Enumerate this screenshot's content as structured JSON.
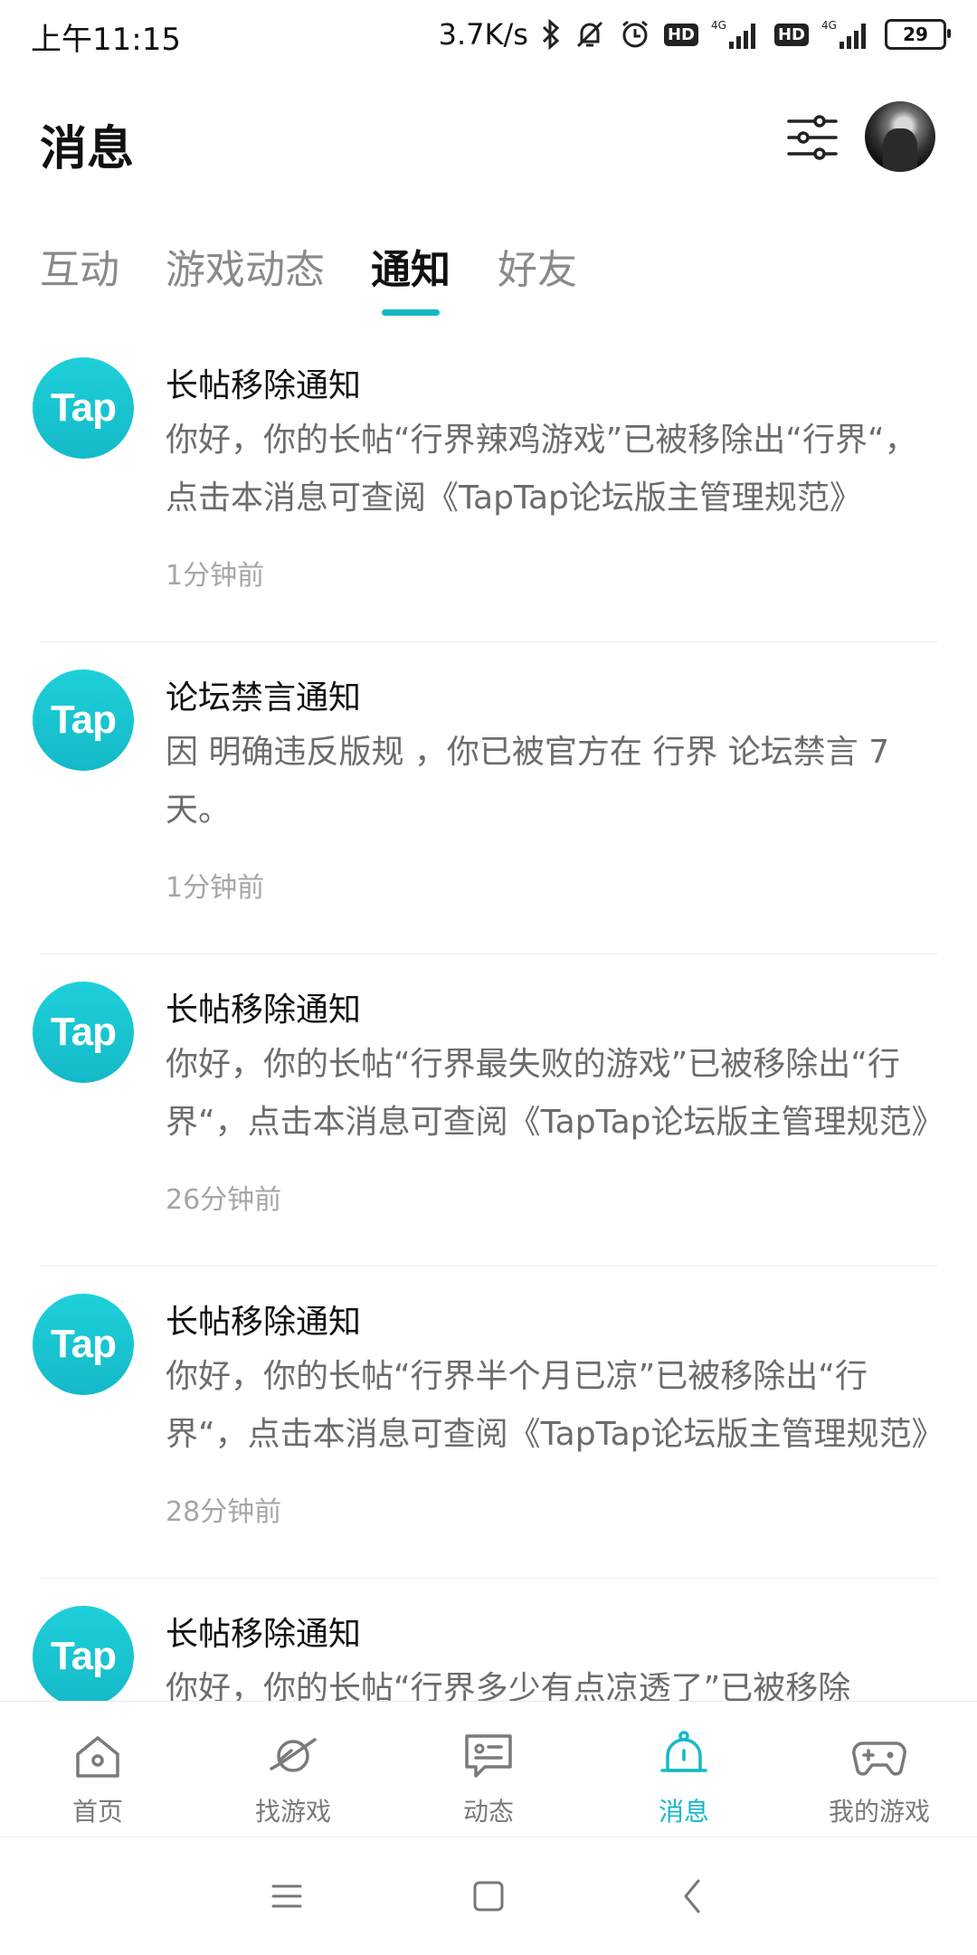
{
  "status_bar": {
    "time": "上午11:15",
    "net_speed": "3.7K/s",
    "battery": "29",
    "hd1": "HD",
    "hd2": "HD",
    "sig1": "4G",
    "sig2": "4G"
  },
  "header": {
    "title": "消息"
  },
  "tabs": [
    {
      "label": "互动"
    },
    {
      "label": "游戏动态"
    },
    {
      "label": "通知",
      "active": true
    },
    {
      "label": "好友"
    }
  ],
  "notifications": [
    {
      "logo": "Tap",
      "title": "长帖移除通知",
      "body": "你好，你的长帖“行界辣鸡游戏”已被移除出“行界“，点击本消息可查阅《TapTap论坛版主管理规范》",
      "time": "1分钟前"
    },
    {
      "logo": "Tap",
      "title": "论坛禁言通知",
      "body": "因 明确违反版规 ，你已被官方在 行界 论坛禁言 7 天。",
      "time": "1分钟前"
    },
    {
      "logo": "Tap",
      "title": "长帖移除通知",
      "body": "你好，你的长帖“行界最失败的游戏”已被移除出“行界“，点击本消息可查阅《TapTap论坛版主管理规范》",
      "time": "26分钟前"
    },
    {
      "logo": "Tap",
      "title": "长帖移除通知",
      "body": "你好，你的长帖“行界半个月已凉”已被移除出“行界“，点击本消息可查阅《TapTap论坛版主管理规范》",
      "time": "28分钟前"
    },
    {
      "logo": "Tap",
      "title": "长帖移除通知",
      "body": "你好，你的长帖“行界多少有点凉透了”已被移除",
      "time": ""
    }
  ],
  "bottom_nav": [
    {
      "label": "首页",
      "icon": "home-icon"
    },
    {
      "label": "找游戏",
      "icon": "planet-icon"
    },
    {
      "label": "动态",
      "icon": "feed-icon"
    },
    {
      "label": "消息",
      "icon": "bell-icon",
      "active": true
    },
    {
      "label": "我的游戏",
      "icon": "gamepad-icon"
    }
  ],
  "colors": {
    "accent": "#14b9c8",
    "text_secondary": "#6c6c6c",
    "text_time": "#a6a6a6"
  }
}
